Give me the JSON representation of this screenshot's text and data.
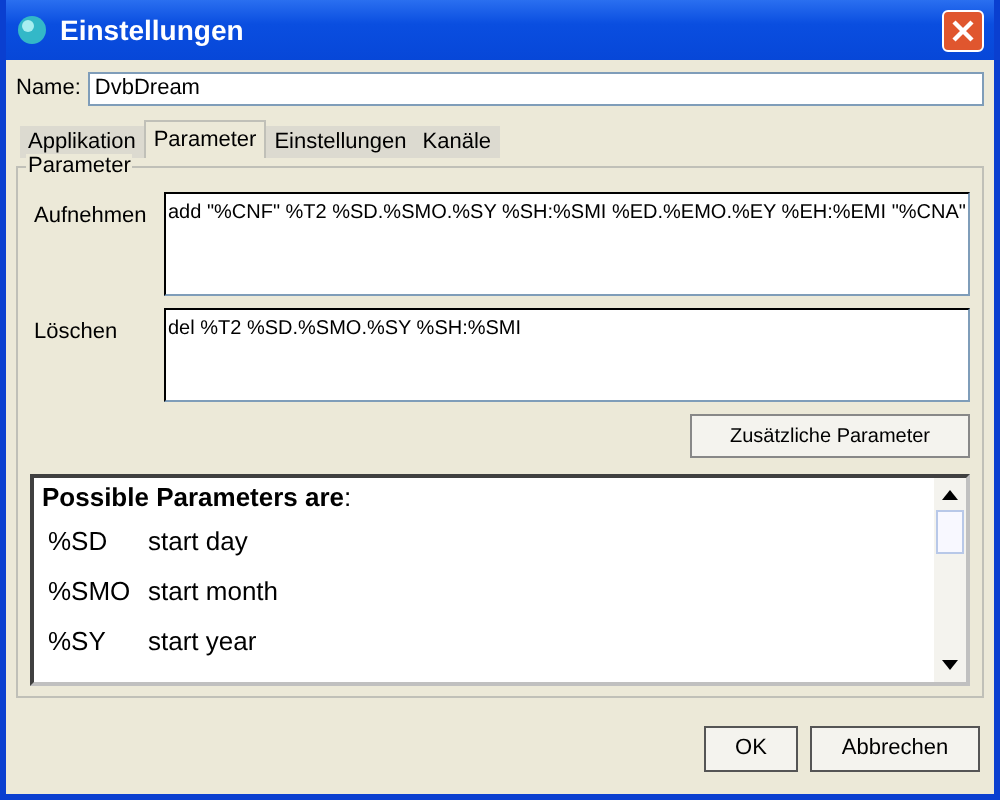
{
  "window": {
    "title": "Einstellungen"
  },
  "name_field": {
    "label": "Name:",
    "value": "DvbDream"
  },
  "tabs": [
    {
      "label": "Applikation",
      "selected": false
    },
    {
      "label": "Parameter",
      "selected": true
    },
    {
      "label": "Einstellungen",
      "selected": false
    },
    {
      "label": "Kanäle",
      "selected": false
    }
  ],
  "group": {
    "title": "Parameter",
    "fields": [
      {
        "label": "Aufnehmen",
        "value": "add \"%CNF\" %T2 %SD.%SMO.%SY %SH:%SMI %ED.%EMO.%EY %EH:%EMI \"%CNA\""
      },
      {
        "label": "Löschen",
        "value": "del %T2 %SD.%SMO.%SY %SH:%SMI"
      }
    ],
    "extra_button": "Zusätzliche Parameter",
    "help": {
      "heading": "**Possible Parameters are**:",
      "rows": [
        {
          "code": "%SD",
          "description": "start day"
        },
        {
          "code": "%SMO",
          "description": "start month"
        },
        {
          "code": "%SY",
          "description": "start year"
        }
      ]
    }
  },
  "buttons": [
    "OK",
    "Abbrechen"
  ]
}
